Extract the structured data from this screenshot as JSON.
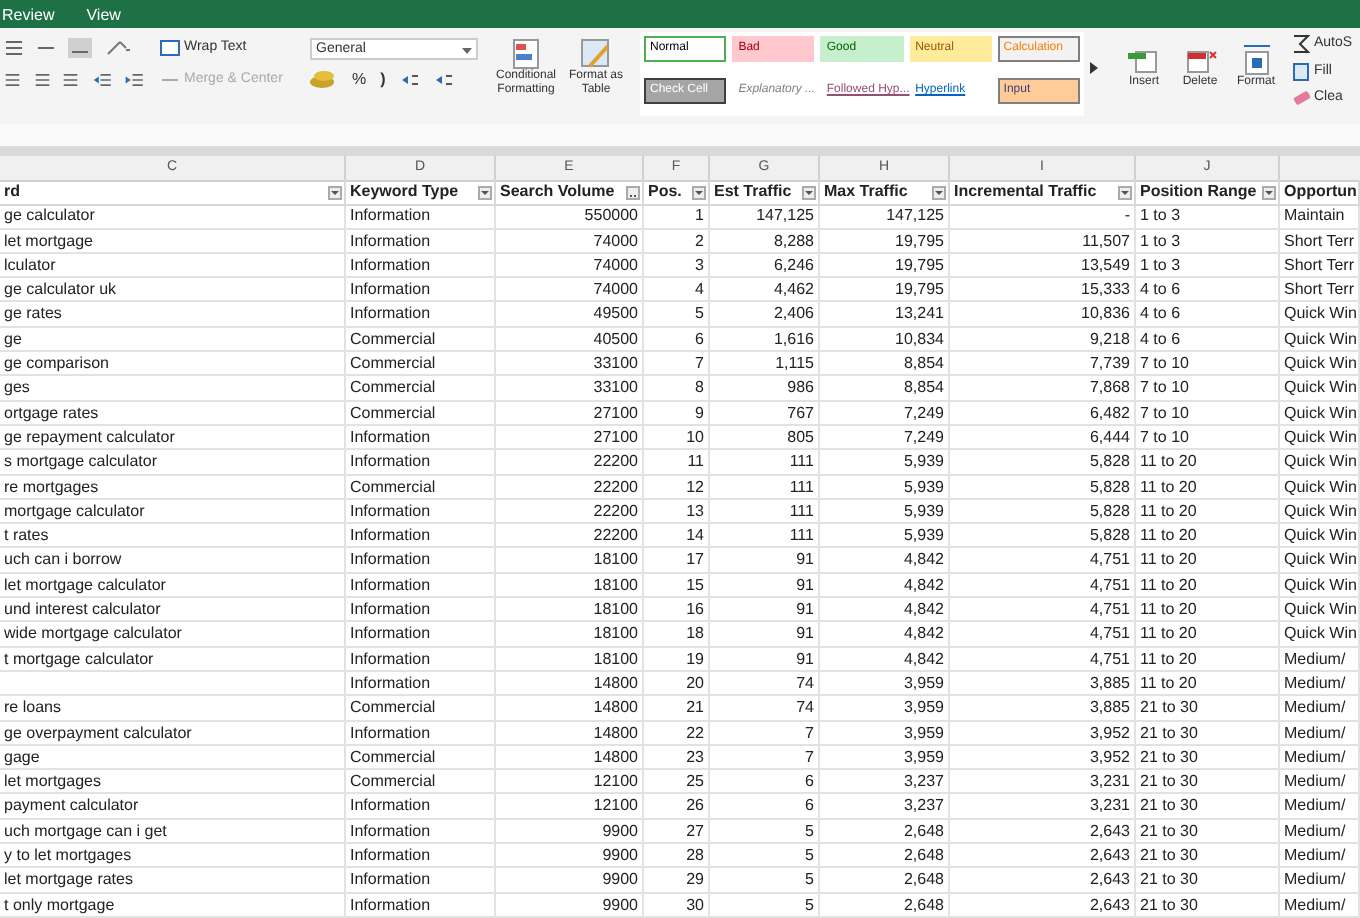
{
  "menu_tabs": [
    {
      "label": "Review",
      "selected": false
    },
    {
      "label": "View",
      "selected": false
    }
  ],
  "ribbon": {
    "wrap_text": "Wrap Text",
    "merge_center": "Merge & Center",
    "number_format": "General",
    "percent": "%",
    "comma": ")",
    "conditional_formatting": "Conditional Formatting",
    "format_as_table": "Format as Table",
    "cell_styles": [
      {
        "label": "Normal",
        "kind": "normal",
        "color": "#ffffff"
      },
      {
        "label": "Bad",
        "kind": "bad",
        "color": "#ffc7ce"
      },
      {
        "label": "Good",
        "kind": "good",
        "color": "#c6efce"
      },
      {
        "label": "Neutral",
        "kind": "neutral",
        "color": "#ffeb9c"
      },
      {
        "label": "Calculation",
        "kind": "calculation",
        "color": "#f2f2f2"
      },
      {
        "label": "Check Cell",
        "kind": "check",
        "color": "#a5a5a5"
      },
      {
        "label": "Explanatory ...",
        "kind": "explanatory",
        "color": "#ffffff"
      },
      {
        "label": "Followed Hyp...",
        "kind": "followed",
        "color": "#ffffff"
      },
      {
        "label": "Hyperlink",
        "kind": "hyperlink",
        "color": "#ffffff"
      },
      {
        "label": "Input",
        "kind": "input",
        "color": "#ffcc99"
      }
    ],
    "cells": [
      "Insert",
      "Delete",
      "Format"
    ],
    "editing": [
      "AutoS",
      "Fill",
      "Clea"
    ]
  },
  "column_letters": [
    "C",
    "D",
    "E",
    "F",
    "G",
    "H",
    "I",
    "J"
  ],
  "table": {
    "columns": [
      "rd",
      "Keyword Type",
      "Search Volume",
      "Pos.",
      "Est Traffic",
      "Max Traffic",
      "Incremental Traffic",
      "Position Range",
      "Opportun"
    ],
    "rows": [
      [
        "ge calculator",
        "Information",
        "550000",
        "1",
        "147,125",
        "147,125",
        "-",
        "1 to 3",
        "Maintain"
      ],
      [
        "let mortgage",
        "Information",
        "74000",
        "2",
        "8,288",
        "19,795",
        "11,507",
        "1 to 3",
        "Short Terr"
      ],
      [
        "lculator",
        "Information",
        "74000",
        "3",
        "6,246",
        "19,795",
        "13,549",
        "1 to 3",
        "Short Terr"
      ],
      [
        "ge calculator uk",
        "Information",
        "74000",
        "4",
        "4,462",
        "19,795",
        "15,333",
        "4 to 6",
        "Short Terr"
      ],
      [
        "ge rates",
        "Information",
        "49500",
        "5",
        "2,406",
        "13,241",
        "10,836",
        "4 to 6",
        "Quick Win"
      ],
      [
        "ge",
        "Commercial",
        "40500",
        "6",
        "1,616",
        "10,834",
        "9,218",
        "4 to 6",
        "Quick Win"
      ],
      [
        "ge comparison",
        "Commercial",
        "33100",
        "7",
        "1,115",
        "8,854",
        "7,739",
        "7 to 10",
        "Quick Win"
      ],
      [
        "ges",
        "Commercial",
        "33100",
        "8",
        "986",
        "8,854",
        "7,868",
        "7 to 10",
        "Quick Win"
      ],
      [
        "ortgage rates",
        "Commercial",
        "27100",
        "9",
        "767",
        "7,249",
        "6,482",
        "7 to 10",
        "Quick Win"
      ],
      [
        "ge repayment calculator",
        "Information",
        "27100",
        "10",
        "805",
        "7,249",
        "6,444",
        "7 to 10",
        "Quick Win"
      ],
      [
        "s mortgage calculator",
        "Information",
        "22200",
        "11",
        "111",
        "5,939",
        "5,828",
        "11 to 20",
        "Quick Win"
      ],
      [
        "re mortgages",
        "Commercial",
        "22200",
        "12",
        "111",
        "5,939",
        "5,828",
        "11 to 20",
        "Quick Win"
      ],
      [
        "mortgage calculator",
        "Information",
        "22200",
        "13",
        "111",
        "5,939",
        "5,828",
        "11 to 20",
        "Quick Win"
      ],
      [
        "t rates",
        "Information",
        "22200",
        "14",
        "111",
        "5,939",
        "5,828",
        "11 to 20",
        "Quick Win"
      ],
      [
        "uch can i borrow",
        "Information",
        "18100",
        "17",
        "91",
        "4,842",
        "4,751",
        "11 to 20",
        "Quick Win"
      ],
      [
        "let mortgage calculator",
        "Information",
        "18100",
        "15",
        "91",
        "4,842",
        "4,751",
        "11 to 20",
        "Quick Win"
      ],
      [
        "und interest calculator",
        "Information",
        "18100",
        "16",
        "91",
        "4,842",
        "4,751",
        "11 to 20",
        "Quick Win"
      ],
      [
        "wide mortgage calculator",
        "Information",
        "18100",
        "18",
        "91",
        "4,842",
        "4,751",
        "11 to 20",
        "Quick Win"
      ],
      [
        "t mortgage calculator",
        "Information",
        "18100",
        "19",
        "91",
        "4,842",
        "4,751",
        "11 to 20",
        "Medium/"
      ],
      [
        null,
        "Information",
        "14800",
        "20",
        "74",
        "3,959",
        "3,885",
        "11 to 20",
        "Medium/"
      ],
      [
        "re loans",
        "Commercial",
        "14800",
        "21",
        "74",
        "3,959",
        "3,885",
        "21 to 30",
        "Medium/"
      ],
      [
        "ge overpayment calculator",
        "Information",
        "14800",
        "22",
        "7",
        "3,959",
        "3,952",
        "21 to 30",
        "Medium/"
      ],
      [
        "gage",
        "Commercial",
        "14800",
        "23",
        "7",
        "3,959",
        "3,952",
        "21 to 30",
        "Medium/"
      ],
      [
        "let mortgages",
        "Commercial",
        "12100",
        "25",
        "6",
        "3,237",
        "3,231",
        "21 to 30",
        "Medium/"
      ],
      [
        "payment calculator",
        "Information",
        "12100",
        "26",
        "6",
        "3,237",
        "3,231",
        "21 to 30",
        "Medium/"
      ],
      [
        "uch mortgage can i get",
        "Information",
        "9900",
        "27",
        "5",
        "2,648",
        "2,643",
        "21 to 30",
        "Medium/"
      ],
      [
        "y to let mortgages",
        "Information",
        "9900",
        "28",
        "5",
        "2,648",
        "2,643",
        "21 to 30",
        "Medium/"
      ],
      [
        "let mortgage rates",
        "Information",
        "9900",
        "29",
        "5",
        "2,648",
        "2,643",
        "21 to 30",
        "Medium/"
      ],
      [
        "t only mortgage",
        "Information",
        "9900",
        "30",
        "5",
        "2,648",
        "2,643",
        "21 to 30",
        "Medium/"
      ]
    ]
  }
}
